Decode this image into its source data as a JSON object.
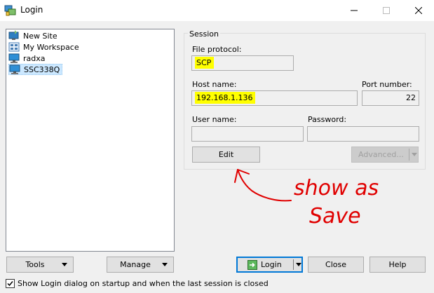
{
  "window": {
    "title": "Login"
  },
  "sites": [
    {
      "label": "New Site",
      "icon": "new-site-icon"
    },
    {
      "label": "My Workspace",
      "icon": "workspace-icon"
    },
    {
      "label": "radxa",
      "icon": "computer-icon"
    },
    {
      "label": "SSC338Q",
      "icon": "computer-icon",
      "selected": true
    }
  ],
  "session": {
    "legend": "Session",
    "file_protocol_label": "File protocol:",
    "file_protocol_value": "SCP",
    "host_name_label": "Host name:",
    "host_name_value": "192.168.1.136",
    "port_label": "Port number:",
    "port_value": "22",
    "user_name_label": "User name:",
    "user_name_value": "",
    "password_label": "Password:",
    "password_value": "",
    "edit_button": "Edit",
    "advanced_button": "Advanced..."
  },
  "annotation": {
    "text_line1": "show as",
    "text_line2": "Save",
    "color": "#e00000"
  },
  "buttons": {
    "tools": "Tools",
    "manage": "Manage",
    "login": "Login",
    "close": "Close",
    "help": "Help"
  },
  "startup_option": {
    "label": "Show Login dialog on startup and when the last session is closed",
    "checked": true
  },
  "colors": {
    "highlight": "#ffff00",
    "selection": "#cce8ff",
    "accent": "#0078d7"
  }
}
